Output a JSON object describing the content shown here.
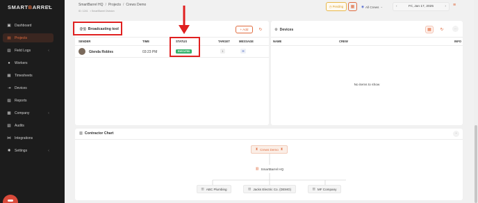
{
  "app": {
    "logo_part1": "SMART",
    "logo_part2": "B",
    "logo_part3": "ARREL",
    "accent_color": "#e06b3e"
  },
  "sidebar": {
    "items": [
      {
        "label": "Dashboard",
        "icon": "dashboard-icon",
        "glyph": "▣"
      },
      {
        "label": "Projects",
        "icon": "projects-icon",
        "glyph": "▤",
        "active": true
      },
      {
        "label": "Field Logs",
        "icon": "field-logs-icon",
        "glyph": "▥",
        "chevron": true
      },
      {
        "label": "Workers",
        "icon": "workers-icon",
        "glyph": "●"
      },
      {
        "label": "Timesheets",
        "icon": "timesheets-icon",
        "glyph": "▦"
      },
      {
        "label": "Devices",
        "icon": "devices-icon",
        "glyph": "⇥"
      },
      {
        "label": "Reports",
        "icon": "reports-icon",
        "glyph": "▨"
      },
      {
        "label": "Company",
        "icon": "company-icon",
        "glyph": "▩",
        "chevron": true
      },
      {
        "label": "Audits",
        "icon": "audits-icon",
        "glyph": "▧"
      },
      {
        "label": "Integrations",
        "icon": "integrations-icon",
        "glyph": "⋈"
      },
      {
        "label": "Settings",
        "icon": "settings-icon",
        "glyph": "✺",
        "chevron": true
      }
    ]
  },
  "header": {
    "breadcrumb": [
      "SmartBarrel HQ",
      "Projects",
      "Crews Demo"
    ],
    "sub_id": "ID: 1241",
    "sub_division": "SmartBarrel Division",
    "pending_label": "Pending",
    "crews_label": "All Crews",
    "date": "Fri, Jan 17, 2025"
  },
  "broadcast": {
    "title": "Broadcasting tool",
    "add_label": "+ Add",
    "columns": [
      "SENDER",
      "TIME",
      "STATUS",
      "TARGET",
      "MESSAGE"
    ],
    "rows": [
      {
        "sender": "Glenda Robles",
        "time": "03:23 PM",
        "status": "EXECUTED",
        "target": "1"
      }
    ]
  },
  "devices": {
    "title": "Devices",
    "columns": [
      "NAME",
      "CREW",
      "INFO"
    ],
    "empty_text": "No items to show"
  },
  "contractor_chart": {
    "title": "Contractor Chart",
    "root": "Crews Demo",
    "level1": "SmartBarrel HQ",
    "level2": [
      "ABC Plumbing",
      "Jacks Electric Co. (DEMO)",
      "MF Company"
    ]
  }
}
